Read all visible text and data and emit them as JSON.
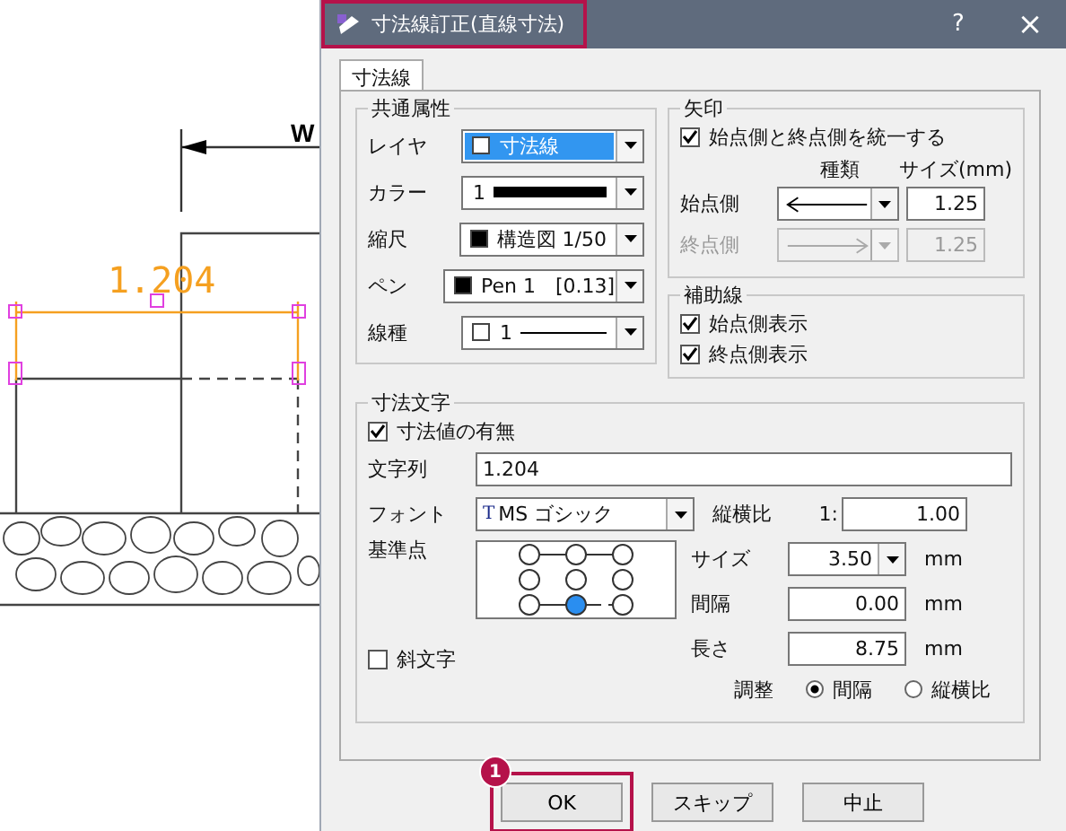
{
  "drawing": {
    "label": "W",
    "dimension_text": "1.204"
  },
  "dialog": {
    "title": "寸法線訂正(直線寸法)",
    "highlighted": true,
    "help": "?",
    "close": "×"
  },
  "tabs": [
    {
      "label": "寸法線",
      "selected": true
    }
  ],
  "common": {
    "title": "共通属性",
    "rows": [
      {
        "label": "レイヤ",
        "kind": "layer",
        "swatch_filled": false,
        "value": "寸法線",
        "focused": true
      },
      {
        "label": "カラー",
        "kind": "color",
        "value": "1",
        "focused": false
      },
      {
        "label": "縮尺",
        "kind": "swatch",
        "swatch_filled": true,
        "value": "構造図 1/50",
        "focused": false
      },
      {
        "label": "ペン",
        "kind": "pen",
        "swatch_filled": true,
        "value": "Pen 1",
        "extra": "[0.13]",
        "focused": false
      },
      {
        "label": "線種",
        "kind": "linetype",
        "swatch_filled": false,
        "value": "1",
        "focused": false
      }
    ]
  },
  "arrow": {
    "title": "矢印",
    "unify": {
      "label": "始点側と終点側を統一する",
      "checked": true
    },
    "col_type": "種類",
    "col_size": "サイズ(mm)",
    "rows": [
      {
        "label": "始点側",
        "kind": "start",
        "size": "1.25",
        "disabled": false
      },
      {
        "label": "終点側",
        "kind": "end",
        "size": "1.25",
        "disabled": true
      }
    ]
  },
  "aux": {
    "title": "補助線",
    "checks": [
      {
        "label": "始点側表示",
        "checked": true
      },
      {
        "label": "終点側表示",
        "checked": true
      }
    ]
  },
  "text": {
    "title": "寸法文字",
    "show_value": {
      "label": "寸法値の有無",
      "checked": true
    },
    "string_label": "文字列",
    "string_value": "1.204",
    "font_label": "フォント",
    "font_icon": "T",
    "font_value": "MS ゴシック",
    "ratio_label": "縦横比",
    "ratio_prefix": "1:",
    "ratio_value": "1.00",
    "anchor_label": "基準点",
    "anchor_points": [
      {
        "selected": false
      },
      {
        "selected": false
      },
      {
        "selected": false
      },
      {
        "selected": false
      },
      {
        "selected": false
      },
      {
        "selected": false
      },
      {
        "selected": false
      },
      {
        "selected": true
      },
      {
        "selected": false
      }
    ],
    "italic": {
      "label": "斜文字",
      "checked": false
    },
    "measures": [
      {
        "label": "サイズ",
        "value": "3.50",
        "unit": "mm",
        "kind": "dropdown"
      },
      {
        "label": "間隔",
        "value": "0.00",
        "unit": "mm",
        "kind": "field"
      },
      {
        "label": "長さ",
        "value": "8.75",
        "unit": "mm",
        "kind": "field"
      }
    ],
    "adjust_label": "調整",
    "adjust_options": [
      {
        "label": "間隔",
        "selected": true
      },
      {
        "label": "縦横比",
        "selected": false
      }
    ]
  },
  "buttons": [
    {
      "label": "OK",
      "highlighted": true,
      "badge": "1"
    },
    {
      "label": "スキップ",
      "highlighted": false
    },
    {
      "label": "中止",
      "highlighted": false
    }
  ]
}
